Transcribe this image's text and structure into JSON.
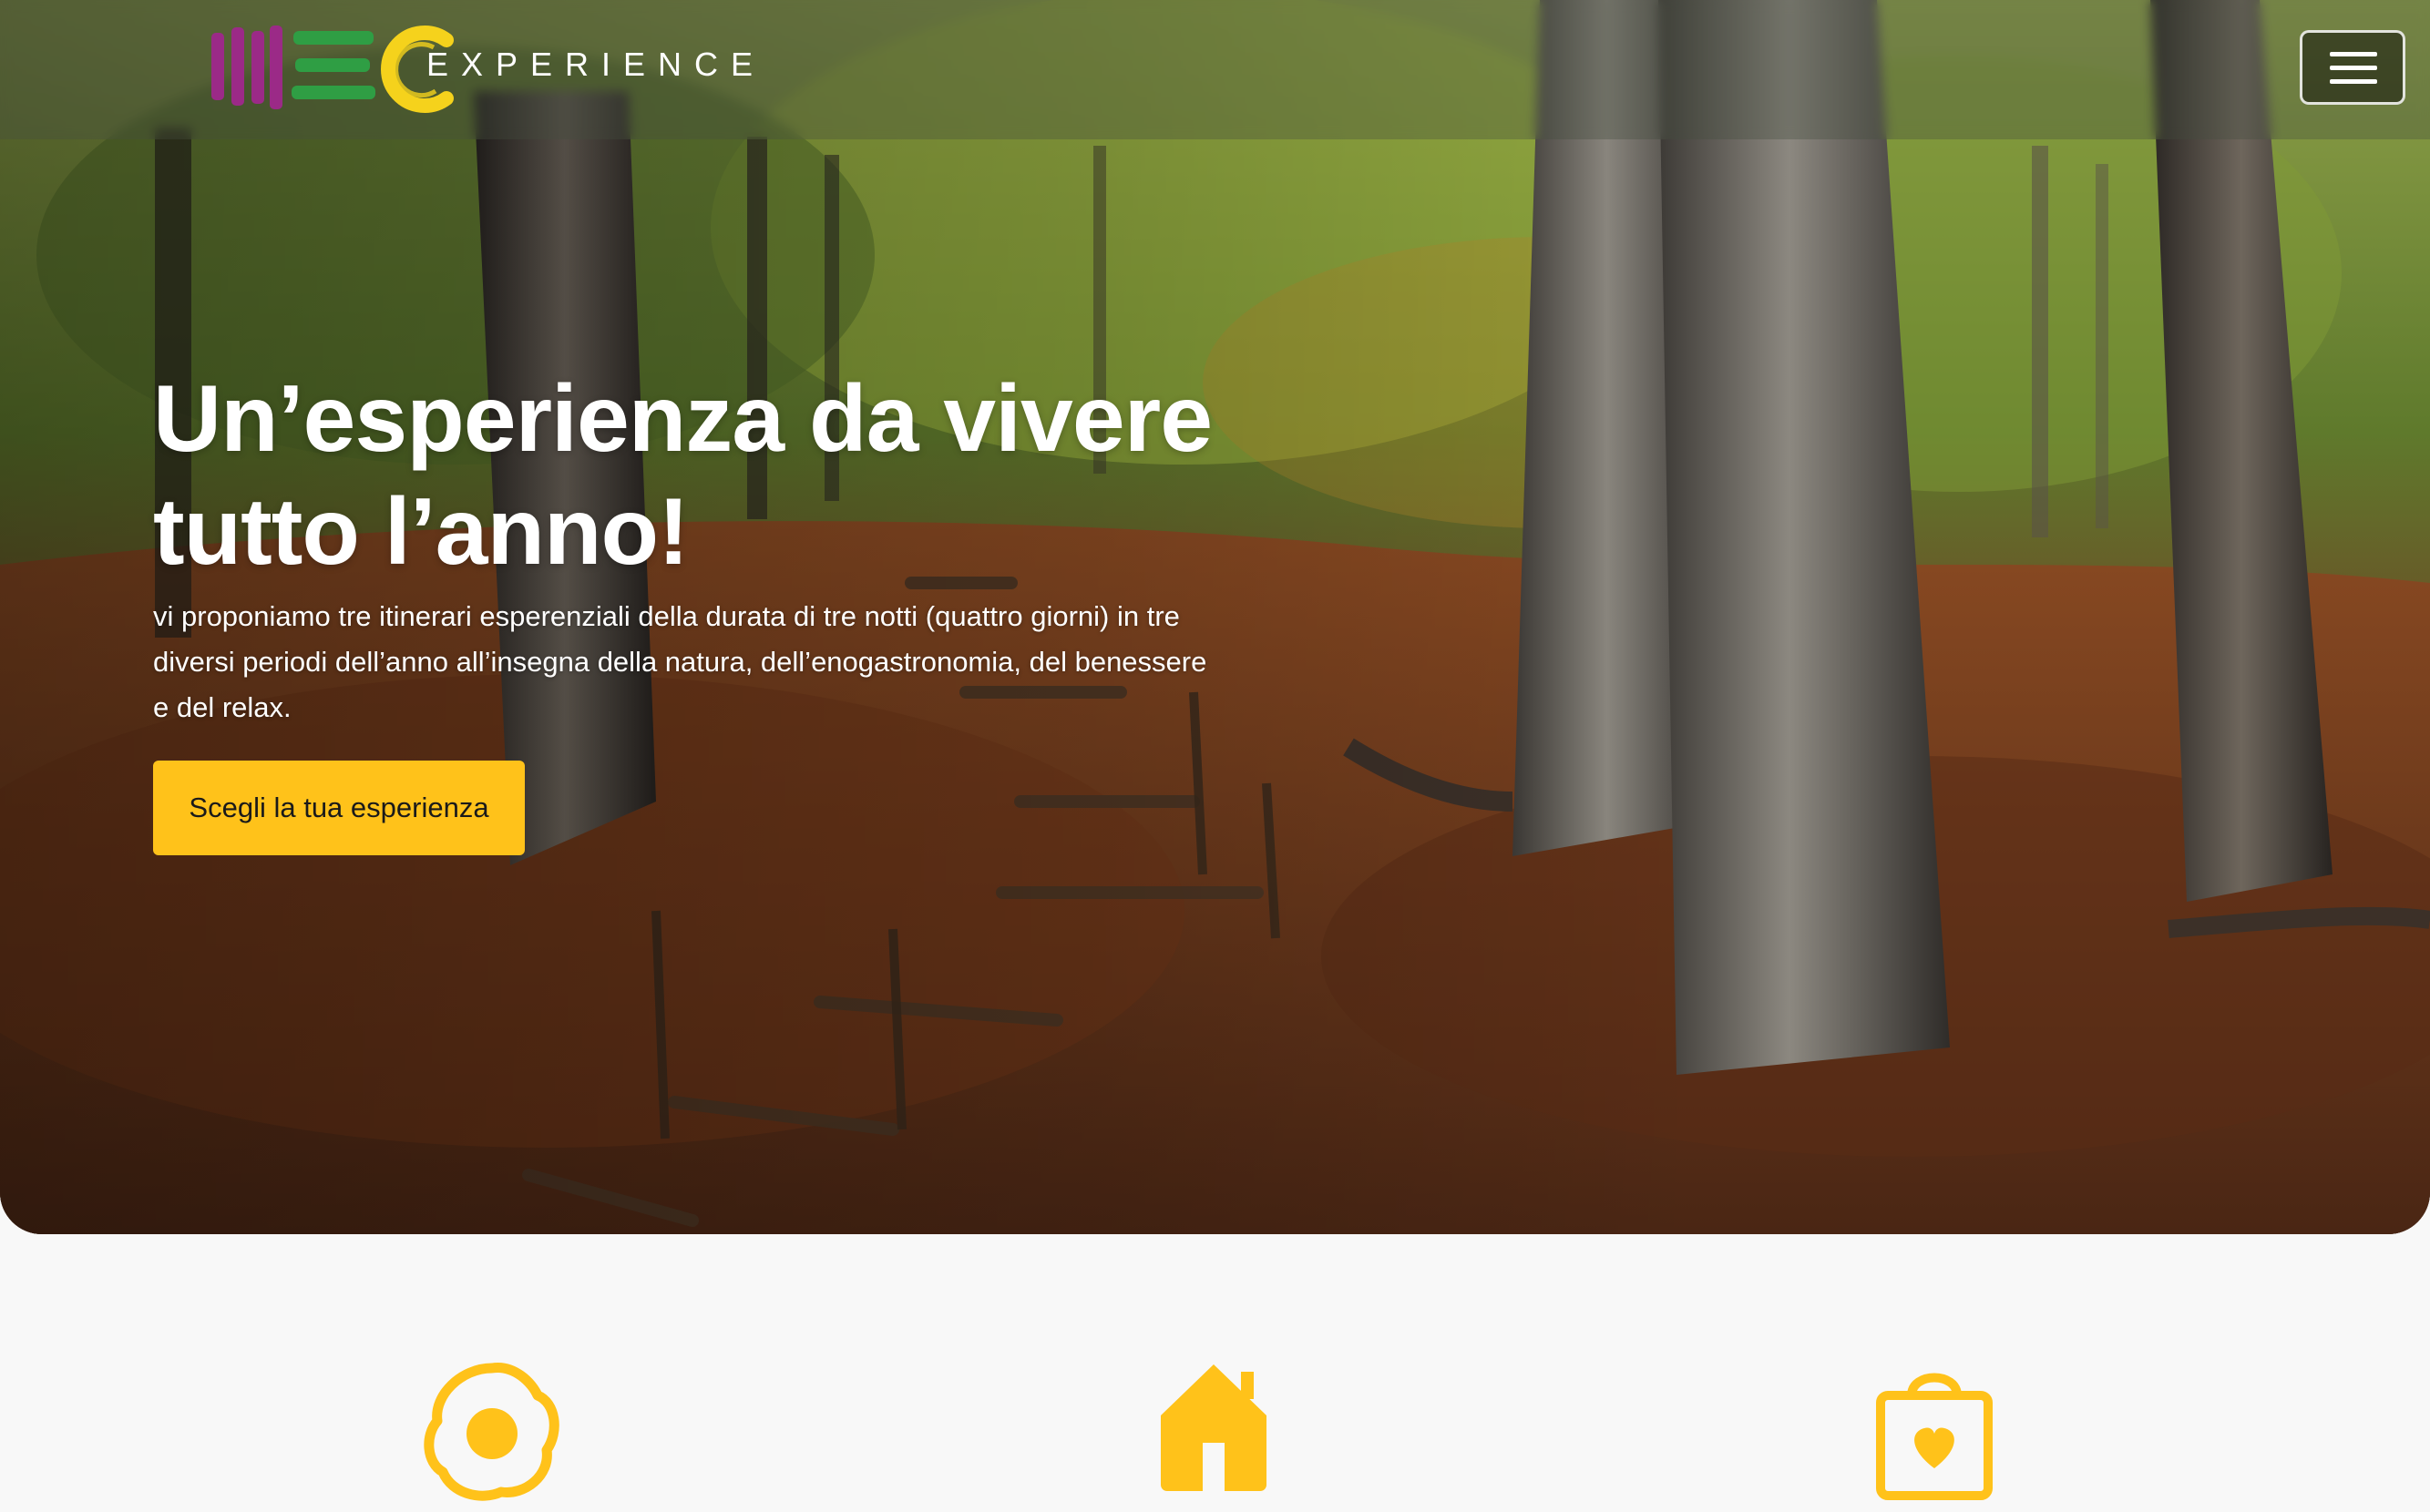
{
  "navbar": {
    "logo_text": "EXPERIENCE",
    "menu_icon": "hamburger-menu-icon"
  },
  "hero": {
    "title_line1": "Un’esperienza da vivere",
    "title_line2": "tutto l’anno!",
    "subtitle": "vi proponiamo tre itinerari esperenziali della durata di tre notti (quattro giorni) in tre diversi periodi dell’anno all’insegna della natura, dell’enogastronomia, del benessere e del relax.",
    "cta_label": "Scegli la tua esperienza"
  },
  "features": [
    {
      "icon": "fried-egg-icon"
    },
    {
      "icon": "house-icon"
    },
    {
      "icon": "shopping-bag-heart-icon"
    }
  ],
  "colors": {
    "accent": "#ffc21a",
    "logo_purple": "#9b2a87",
    "logo_green": "#2f9e44",
    "logo_yellow": "#f5d21c",
    "background": "#f8f8f8"
  }
}
